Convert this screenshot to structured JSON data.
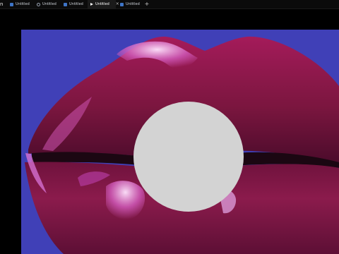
{
  "tabs": [
    {
      "label": "Untitled"
    },
    {
      "label": "Untitled"
    },
    {
      "label": "Untitled"
    },
    {
      "label": "Untitled",
      "active": true
    },
    {
      "label": "Untitled"
    }
  ],
  "new_tab_label": "+",
  "close_label": "×",
  "logo_glyph": "n",
  "colors": {
    "canvas_bg": "#4040b7",
    "lip_dark": "#5f0f3a",
    "lip_mid": "#8c1c4e",
    "lip_highlight": "#d05ab9",
    "circle": "#d3d3d3"
  }
}
